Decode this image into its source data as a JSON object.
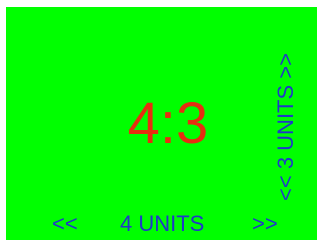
{
  "diagram": {
    "ratio_text": "4:3",
    "bottom_dimension": {
      "left_arrow": "<<",
      "text": "4 UNITS",
      "right_arrow": ">>"
    },
    "side_dimension": {
      "text": "<< 3 UNITS >>"
    },
    "colors": {
      "background": "#00ff00",
      "ratio_text": "#e62e10",
      "dimension_text": "#1f39c8"
    }
  }
}
